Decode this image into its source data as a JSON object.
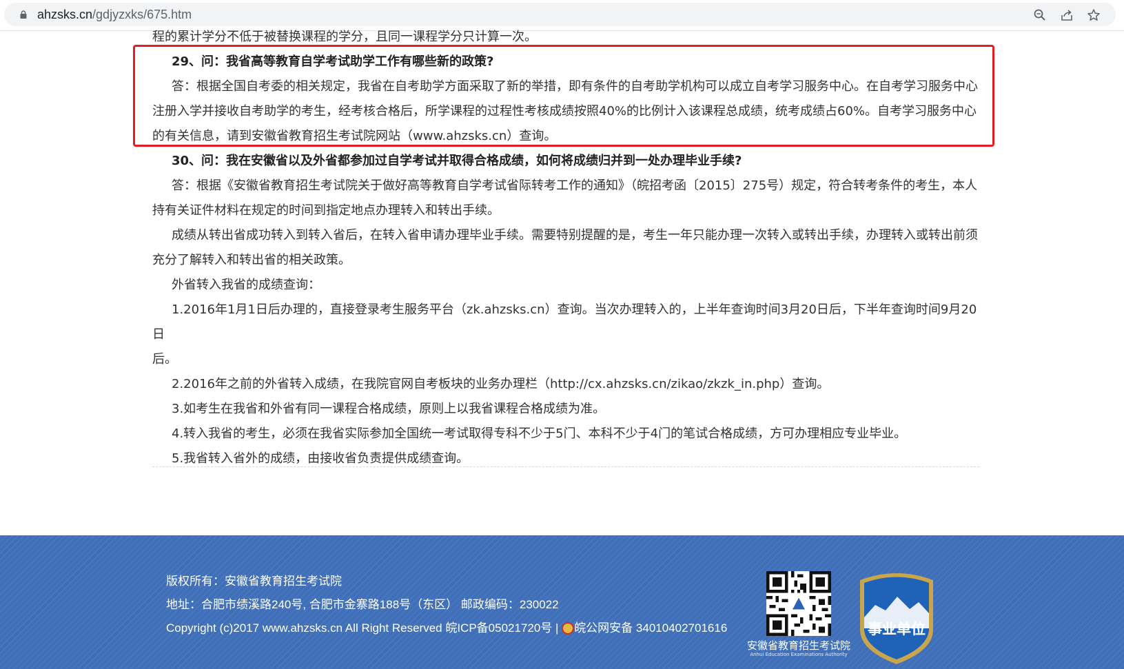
{
  "browser": {
    "url_domain": "ahzsks.cn",
    "url_path": "/gdjyzxks/675.htm",
    "icons": [
      "lock-icon",
      "zoom-icon",
      "share-icon",
      "star-icon"
    ]
  },
  "article": {
    "top_partial": "程的累计学分不低于被替换课程的学分，且同一课程学分只计算一次。",
    "q29_title": "29、问：我省高等教育自学考试助学工作有哪些新的政策?",
    "q29_answer_l1": "答：根据全国自考委的相关规定，我省在自考助学方面采取了新的举措，即有条件的自考助学机构可以成立自考学习服务中心。在自考学习服务中心",
    "q29_answer_l2": "注册入学并接收自考助学的考生，经考核合格后，所学课程的过程性考核成绩按照40%的比例计入该课程总成绩，统考成绩占60%。自考学习服务中心",
    "q29_answer_l3": "的有关信息，请到安徽省教育招生考试院网站（www.ahzsks.cn）查询。",
    "q30_title": "30、问：我在安徽省以及外省都参加过自学考试并取得合格成绩，如何将成绩归并到一处办理毕业手续?",
    "q30_p1_l1": "答：根据《安徽省教育招生考试院关于做好高等教育自学考试省际转考工作的通知》（皖招考函〔2015〕275号）规定，符合转考条件的考生，本人",
    "q30_p1_l2": "持有关证件材料在规定的时间到指定地点办理转入和转出手续。",
    "q30_p2_l1": "成绩从转出省成功转入到转入省后，在转入省申请办理毕业手续。需要特别提醒的是，考生一年只能办理一次转入或转出手续，办理转入或转出前须",
    "q30_p2_l2": "充分了解转入和转出省的相关政策。",
    "q30_p3": "外省转入我省的成绩查询：",
    "item1_l1": "1.2016年1月1日后办理的，直接登录考生服务平台（zk.ahzsks.cn）查询。当次办理转入的，上半年查询时间3月20日后，下半年查询时间9月20日",
    "item1_l2": "后。",
    "item2": "2.2016年之前的外省转入成绩，在我院官网自考板块的业务办理栏（http://cx.ahzsks.cn/zikao/zkzk_in.php）查询。",
    "item3": "3.如考生在我省和外省有同一课程合格成绩，原则上以我省课程合格成绩为准。",
    "item4": "4.转入我省的考生，必须在我省实际参加全国统一考试取得专科不少于5门、本科不少于4门的笔试合格成绩，方可办理相应专业毕业。",
    "item5": "5.我省转入省外的成绩，由接收省负责提供成绩查询。"
  },
  "footer": {
    "copyright_owner": "版权所有：安徽省教育招生考试院",
    "address": "地址：合肥市绩溪路240号, 合肥市金寨路188号（东区） 邮政编码：230022",
    "copyright_line": "Copyright (c)2017 www.ahzsks.cn All Right Reserved 皖ICP备05021720号 |",
    "police_record": "皖公网安备 34010402701616",
    "qr_caption": "安徽省教育招生考试院",
    "qr_caption_en": "Anhui Education Examinations Authority",
    "badge_text": "事业单位"
  },
  "colors": {
    "highlight_border": "#e51c23",
    "footer_bg": "#3f6fb8",
    "badge_bg": "#1e63b8",
    "badge_border": "#c9a64c"
  }
}
